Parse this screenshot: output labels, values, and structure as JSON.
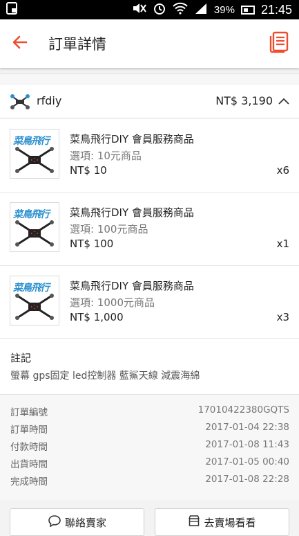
{
  "status": {
    "battery": "39%",
    "time": "21:45"
  },
  "header": {
    "title": "訂單詳情"
  },
  "shop": {
    "name": "rfdiy",
    "total": "NT$ 3,190"
  },
  "items": [
    {
      "name": "菜鳥飛行DIY 會員服務商品",
      "option": "選項: 10元商品",
      "price": "NT$ 10",
      "qty": "x6",
      "logo": "菜鳥飛行"
    },
    {
      "name": "菜鳥飛行DIY 會員服務商品",
      "option": "選項: 100元商品",
      "price": "NT$ 100",
      "qty": "x1",
      "logo": "菜鳥飛行"
    },
    {
      "name": "菜鳥飛行DIY 會員服務商品",
      "option": "選項: 1000元商品",
      "price": "NT$ 1,000",
      "qty": "x3",
      "logo": "菜鳥飛行"
    }
  ],
  "note": {
    "title": "註記",
    "text": "螢幕 gps固定 led控制器 藍鯊天線 減震海綿"
  },
  "info": [
    {
      "label": "訂單編號",
      "value": "17010422380GQTS"
    },
    {
      "label": "訂單時間",
      "value": "2017-01-04 22:38"
    },
    {
      "label": "付款時間",
      "value": "2017-01-08 11:43"
    },
    {
      "label": "出貨時間",
      "value": "2017-01-05 00:40"
    },
    {
      "label": "完成時間",
      "value": "2017-01-08 22:28"
    }
  ],
  "actions": {
    "contact": "聯絡賣家",
    "visit": "去賣場看看"
  },
  "colors": {
    "accent": "#ee4d2d",
    "logo_blue": "#2a8fcf"
  }
}
